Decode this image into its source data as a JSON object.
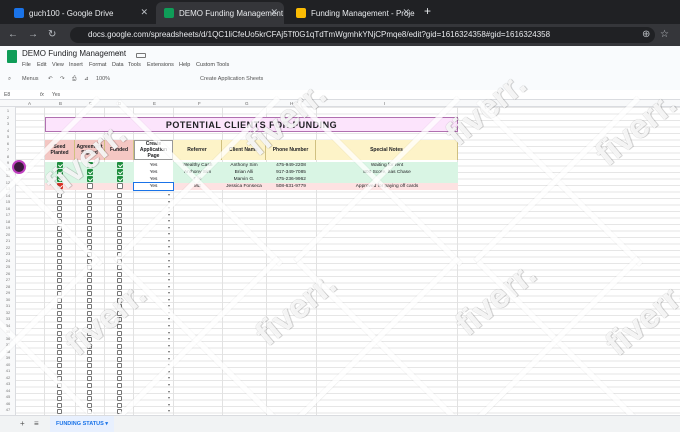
{
  "browser": {
    "tabs": [
      {
        "title": "guch100 - Google Drive",
        "color": "#1a73e8"
      },
      {
        "title": "DEMO Funding Management",
        "color": "#0f9d58"
      },
      {
        "title": "Funding Management - Proje",
        "color": "#fbbc04"
      }
    ],
    "url": "docs.google.com/spreadsheets/d/1QC1liCfeUo5krCFAj5Tf0G1qTdTmWgmhkYNjCPmqe8/edit?gid=1616324358#gid=1616324358"
  },
  "sheet": {
    "doc_title": "DEMO Funding Management",
    "menus": [
      "File",
      "Edit",
      "View",
      "Insert",
      "Format",
      "Data",
      "Tools",
      "Extensions",
      "Help",
      "Custom Tools"
    ],
    "toolbar_label": "Menus",
    "create_sheets": "Create Application Sheets",
    "zoom": "100%",
    "name_box": "E8",
    "formula": "Yes"
  },
  "columns": [
    "A",
    "B",
    "C",
    "D",
    "E",
    "F",
    "G",
    "H",
    "I"
  ],
  "title": "POTENTIAL CLIENTS FOR FUNDING",
  "headers": {
    "seed": "Seed Planted",
    "agreement": "Agreement Signed",
    "funded": "Funded",
    "create": "Create Application Page",
    "referrer": "Referrer",
    "client": "Client Name",
    "phone": "Phone Number",
    "notes": "Special Notes"
  },
  "rows": [
    {
      "create": "Yes",
      "referrer": "Wealthy Cash",
      "client": "Anthony Sim",
      "phone": "475-949-2208",
      "notes": "Waiting for rent"
    },
    {
      "create": "Yes",
      "referrer": "Anthony Sim",
      "client": "Brian Alli",
      "phone": "917-349-7085",
      "notes": "800 Score, has Chase"
    },
    {
      "create": "Yes",
      "referrer": "Elie",
      "client": "Marvin G.",
      "phone": "475-236-9962",
      "notes": ""
    },
    {
      "create": "Yes",
      "referrer": "ME",
      "client": "Jessica Fonseca",
      "phone": "508-631-9779",
      "notes": "Approved for paying off cards"
    }
  ],
  "sheet_tab": "FUNDING STATUS",
  "watermark": "fiverr."
}
